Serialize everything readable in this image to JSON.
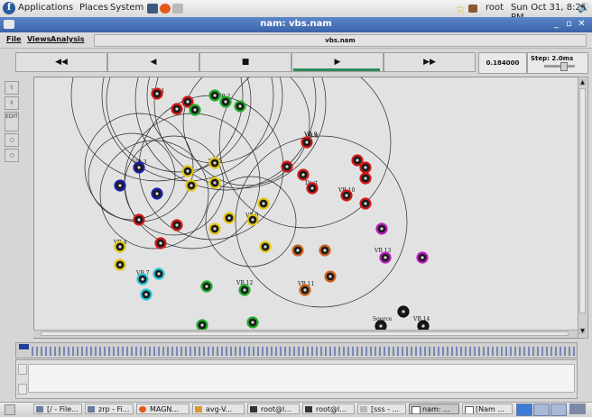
{
  "top_panel": {
    "menus": [
      "Applications",
      "Places",
      "System"
    ],
    "user": "root",
    "clock": "Sun Oct 31,  8:21 PM"
  },
  "window": {
    "title": "nam: vbs.nam"
  },
  "menubar": {
    "items": [
      "File",
      "Views",
      "Analysis"
    ],
    "file_name": "vbs.nam"
  },
  "toolbar": {
    "rewind": "◀◀",
    "back": "◀",
    "stop": "■",
    "play": "▶",
    "fast_forward": "▶▶",
    "time": "0.184000",
    "step": "Step: 2.0ms"
  },
  "left_tools": [
    "EDIT"
  ],
  "canvas": {
    "labels": {
      "vb1": "VB 1",
      "vb2": "VB 2",
      "vb3": "VB 3",
      "vb4": "VB 4",
      "vb5": "VB 5",
      "vb6": "VB 6",
      "vb7": "VB 7",
      "vb8": "VB 8",
      "vb9": "VB 9",
      "vb10": "VB 10",
      "vb11": "VB 11",
      "vb12": "VB 12",
      "vb13": "VB 13",
      "vb14": "VB 14",
      "dest": "Dest",
      "source": "Source"
    },
    "colors": {
      "red": "#d41818",
      "green": "#1fae2a",
      "yellow": "#e2c80f",
      "blue": "#1a1fb0",
      "orange": "#d2641a",
      "cyan": "#20c6d6",
      "magenta": "#c01ac6",
      "black": "#111111"
    }
  },
  "taskbar": {
    "tasks": [
      "[/ - File...",
      "zrp - Fi...",
      "MAGN...",
      "avg-V...",
      "root@l...",
      "root@l...",
      "[sss - ...",
      "nam: ...",
      "[Nam ..."
    ]
  }
}
